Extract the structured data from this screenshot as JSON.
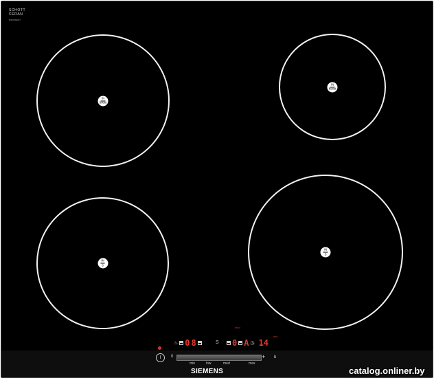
{
  "brand": {
    "line1": "SCHOTT",
    "line2": "CERAN",
    "sub": "BIERSBERT"
  },
  "zones": [
    {
      "top": "IN",
      "bottom": "boost"
    },
    {
      "top": "IN",
      "bottom": "boost"
    },
    {
      "top": "IN",
      "bottom": "S"
    },
    {
      "top": "IN",
      "bottom": "S"
    }
  ],
  "controls": {
    "med_header": "med",
    "min_header": "min",
    "display_left": "0",
    "display_left2": "8",
    "display_mid_s": "S",
    "display_mid": "0",
    "display_mid2": "A",
    "timer_value": "14",
    "power_symbol": "I",
    "slider": {
      "zero": "0",
      "plus": "+",
      "b": "b",
      "min": "min",
      "low": "low",
      "med": "med",
      "max": "max"
    }
  },
  "logo": "SIEMENS",
  "watermark": "catalog.onliner.by",
  "colors": {
    "display": "#e1392f",
    "zone_ring": "#f2f2f2",
    "glass": "#000000"
  }
}
